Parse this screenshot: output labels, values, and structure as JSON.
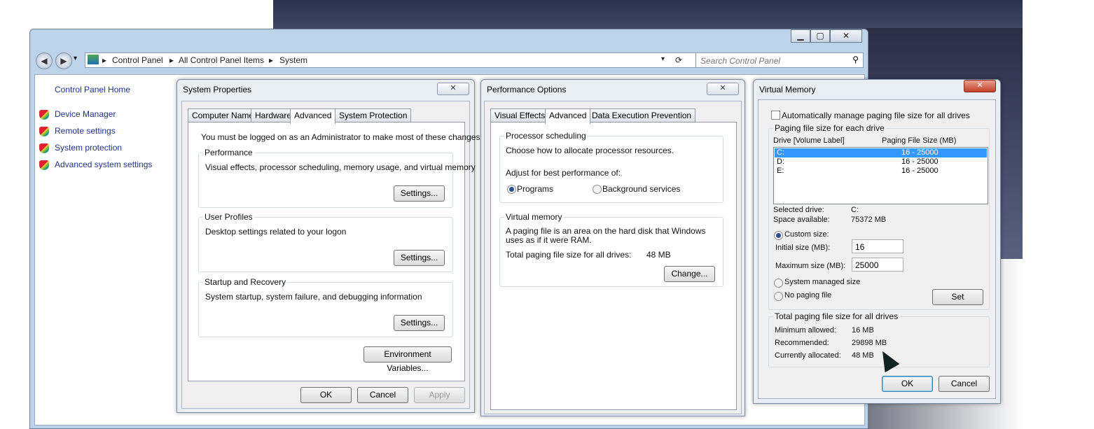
{
  "explorer": {
    "address": [
      "Control Panel",
      "All Control Panel Items",
      "System"
    ],
    "search_placeholder": "Search Control Panel",
    "caption": {
      "minimize": "▁",
      "maximize": "▢",
      "close": "✕"
    },
    "nav": {
      "back": "◀",
      "forward": "▶",
      "dropdown": "▾",
      "refresh": "⟳"
    }
  },
  "sidebar": {
    "home": "Control Panel Home",
    "items": [
      {
        "label": "Device Manager",
        "icon": "shield-icon"
      },
      {
        "label": "Remote settings",
        "icon": "shield-icon"
      },
      {
        "label": "System protection",
        "icon": "shield-icon"
      },
      {
        "label": "Advanced system settings",
        "icon": "shield-icon"
      }
    ]
  },
  "system_properties": {
    "title": "System Properties",
    "close": "✕",
    "tabs": [
      "Computer Name",
      "Hardware",
      "Advanced",
      "System Protection"
    ],
    "active_tab": "Advanced",
    "admin_note": "You must be logged on as an Administrator to make most of these changes.",
    "performance": {
      "title": "Performance",
      "desc": "Visual effects, processor scheduling, memory usage, and virtual memory",
      "button": "Settings..."
    },
    "user_profiles": {
      "title": "User Profiles",
      "desc": "Desktop settings related to your logon",
      "button": "Settings..."
    },
    "startup": {
      "title": "Startup and Recovery",
      "desc": "System startup, system failure, and debugging information",
      "button": "Settings..."
    },
    "env_button": "Environment Variables...",
    "ok": "OK",
    "cancel": "Cancel",
    "apply": "Apply"
  },
  "performance_options": {
    "title": "Performance Options",
    "close": "✕",
    "tabs": [
      "Visual Effects",
      "Advanced",
      "Data Execution Prevention"
    ],
    "active_tab": "Advanced",
    "processor": {
      "title": "Processor scheduling",
      "desc": "Choose how to allocate processor resources.",
      "adjust": "Adjust for best performance of:",
      "programs": "Programs",
      "background": "Background services"
    },
    "virtual_memory": {
      "title": "Virtual memory",
      "desc": "A paging file is an area on the hard disk that Windows uses as if it were RAM.",
      "total_label": "Total paging file size for all drives:",
      "total_value": "48 MB",
      "change": "Change..."
    }
  },
  "virtual_memory": {
    "title": "Virtual Memory",
    "close": "✕",
    "auto_manage": "Automatically manage paging file size for all drives",
    "group_title": "Paging file size for each drive",
    "col_drive": "Drive  [Volume Label]",
    "col_size": "Paging File Size (MB)",
    "drives": [
      {
        "drive": "C:",
        "size": "16 - 25000"
      },
      {
        "drive": "D:",
        "size": "16 - 25000"
      },
      {
        "drive": "E:",
        "size": "16 - 25000"
      }
    ],
    "selected_drive_label": "Selected drive:",
    "selected_drive_value": "C:",
    "space_label": "Space available:",
    "space_value": "75372 MB",
    "custom_size": "Custom size:",
    "initial_label": "Initial size (MB):",
    "initial_value": "16",
    "maximum_label": "Maximum size (MB):",
    "maximum_value": "25000",
    "system_managed": "System managed size",
    "no_paging": "No paging file",
    "set": "Set",
    "totals_title": "Total paging file size for all drives",
    "min_label": "Minimum allowed:",
    "min_value": "16 MB",
    "rec_label": "Recommended:",
    "rec_value": "29898 MB",
    "cur_label": "Currently allocated:",
    "cur_value": "48 MB",
    "ok": "OK",
    "cancel": "Cancel"
  }
}
